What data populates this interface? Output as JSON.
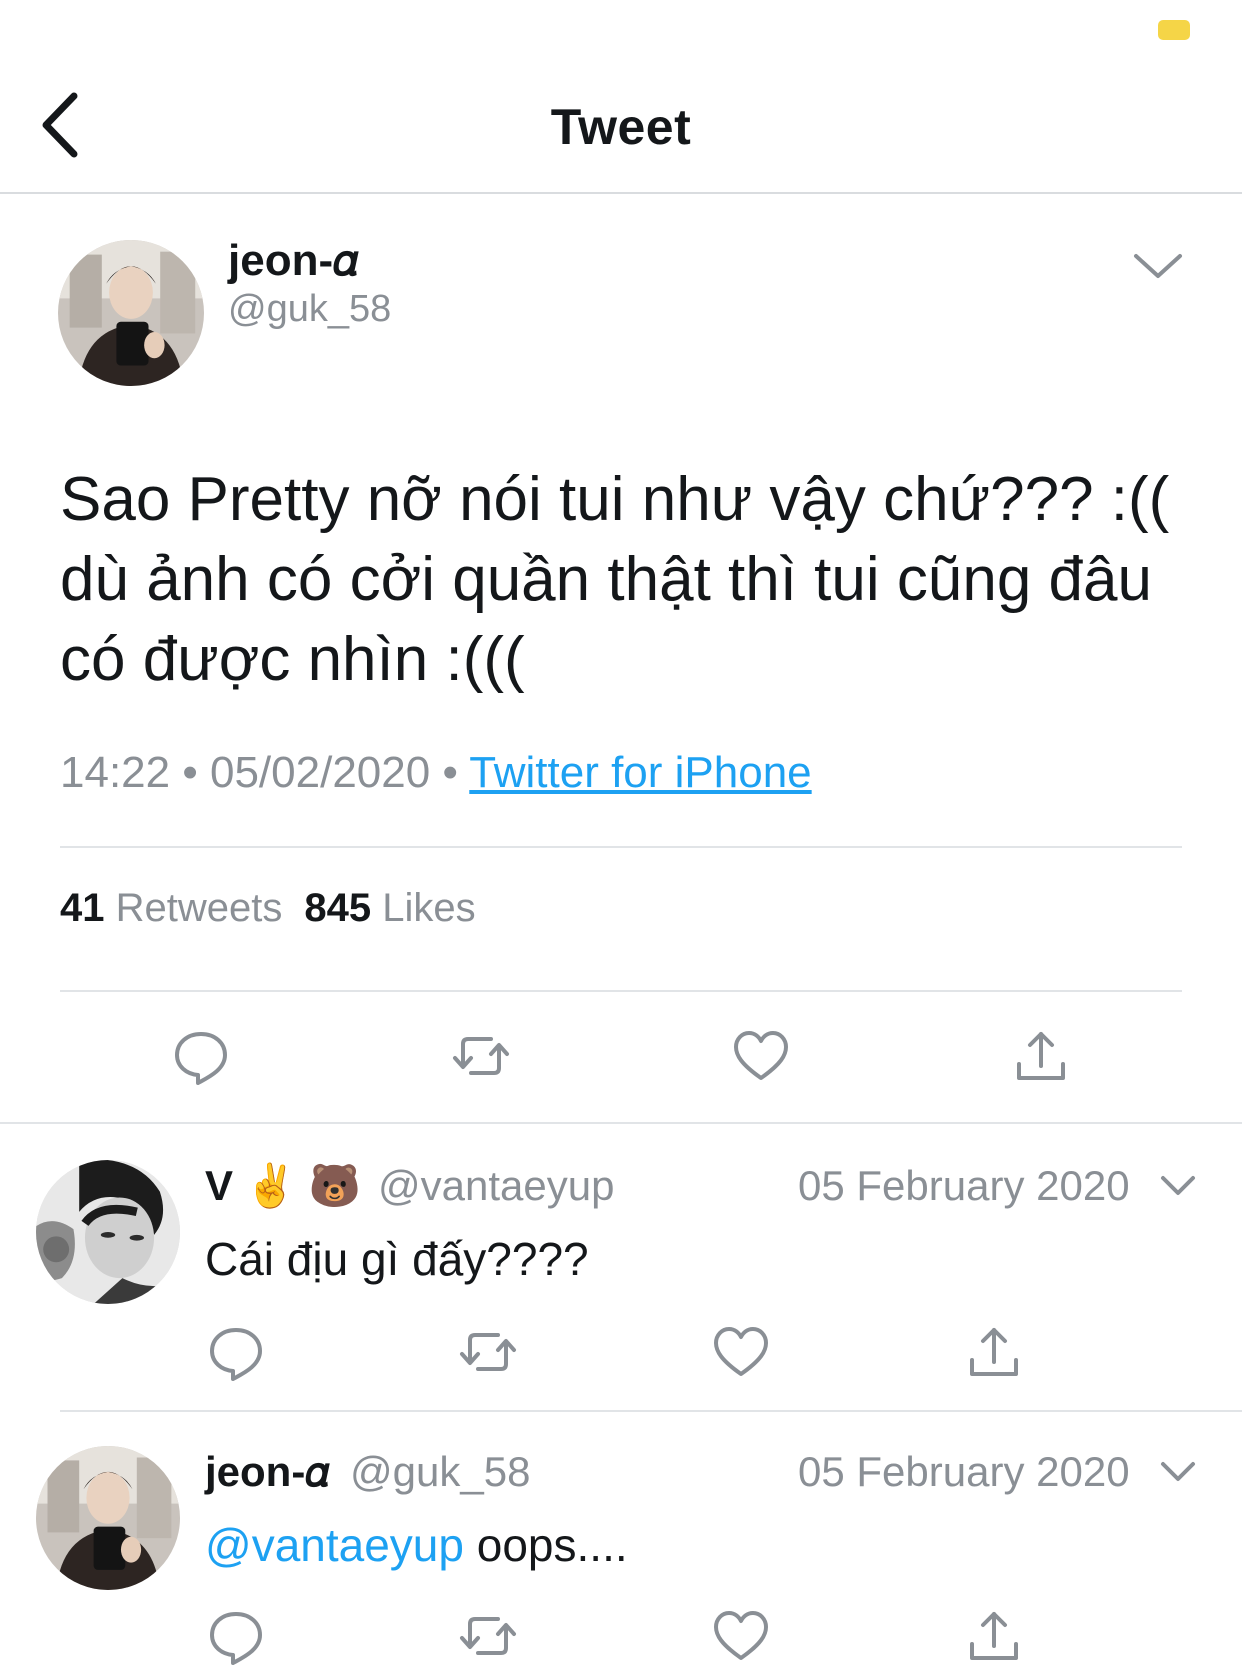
{
  "header": {
    "title": "Tweet"
  },
  "colors": {
    "accent": "#1da1f2",
    "muted": "#8a8f95",
    "text": "#14171a",
    "battery": "#f5d547"
  },
  "tweet": {
    "author_name": "jeon-𝛼",
    "author_handle": "@guk_58",
    "text": "Sao Pretty nỡ nói tui như vậy chứ??? :(( dù ảnh có cởi quần thật thì tui cũng đâu có được nhìn :(((",
    "time": "14:22",
    "date": "05/02/2020",
    "separator": "•",
    "source": "Twitter for iPhone",
    "retweets_count": "41",
    "retweets_label": "Retweets",
    "likes_count": "845",
    "likes_label": "Likes"
  },
  "replies": [
    {
      "name": "V ✌️ 🐻",
      "handle": "@vantaeyup",
      "date": "05 February 2020",
      "text": "Cái địu gì đấy????"
    },
    {
      "name": "jeon-𝛼",
      "handle": "@guk_58",
      "date": "05 February 2020",
      "mention": "@vantaeyup",
      "text": " oops...."
    }
  ],
  "icons": [
    "back-chevron-icon",
    "chevron-down-icon",
    "reply-icon",
    "retweet-icon",
    "like-icon",
    "share-icon"
  ]
}
